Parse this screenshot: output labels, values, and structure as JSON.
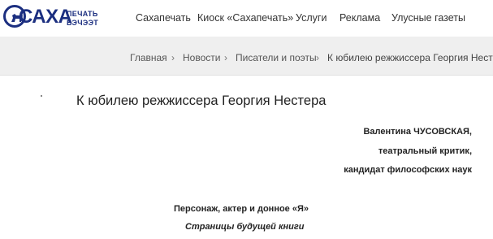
{
  "logo": {
    "brand": "САХА",
    "sub_line_1": "ПЕЧАТЬ",
    "sub_line_2": "БЭЧЭЭТ"
  },
  "nav": {
    "items": [
      {
        "label": "Сахапечать"
      },
      {
        "label": "Киоск «Сахапечать»"
      },
      {
        "label": "Услуги"
      },
      {
        "label": "Реклама"
      },
      {
        "label": "Улусные газеты"
      }
    ]
  },
  "breadcrumb": {
    "items": [
      {
        "label": "Главная"
      },
      {
        "label": "Новости"
      },
      {
        "label": "Писатели и поэты"
      },
      {
        "label": "К юбилею режжиссера Георгия Нестера"
      }
    ],
    "separator": "›"
  },
  "article": {
    "title": "К юбилею режжиссера Георгия Нестера",
    "author_lines": [
      "Валентина ЧУСОВСКАЯ,",
      "театральный критик,",
      "кандидат философских наук"
    ],
    "section_heading": "Персонаж, актер и донное «Я»",
    "section_subheading": "Страницы будущей книги"
  },
  "colors": {
    "brand_blue": "#1c2f80",
    "breadcrumb_bg": "#efefef"
  }
}
